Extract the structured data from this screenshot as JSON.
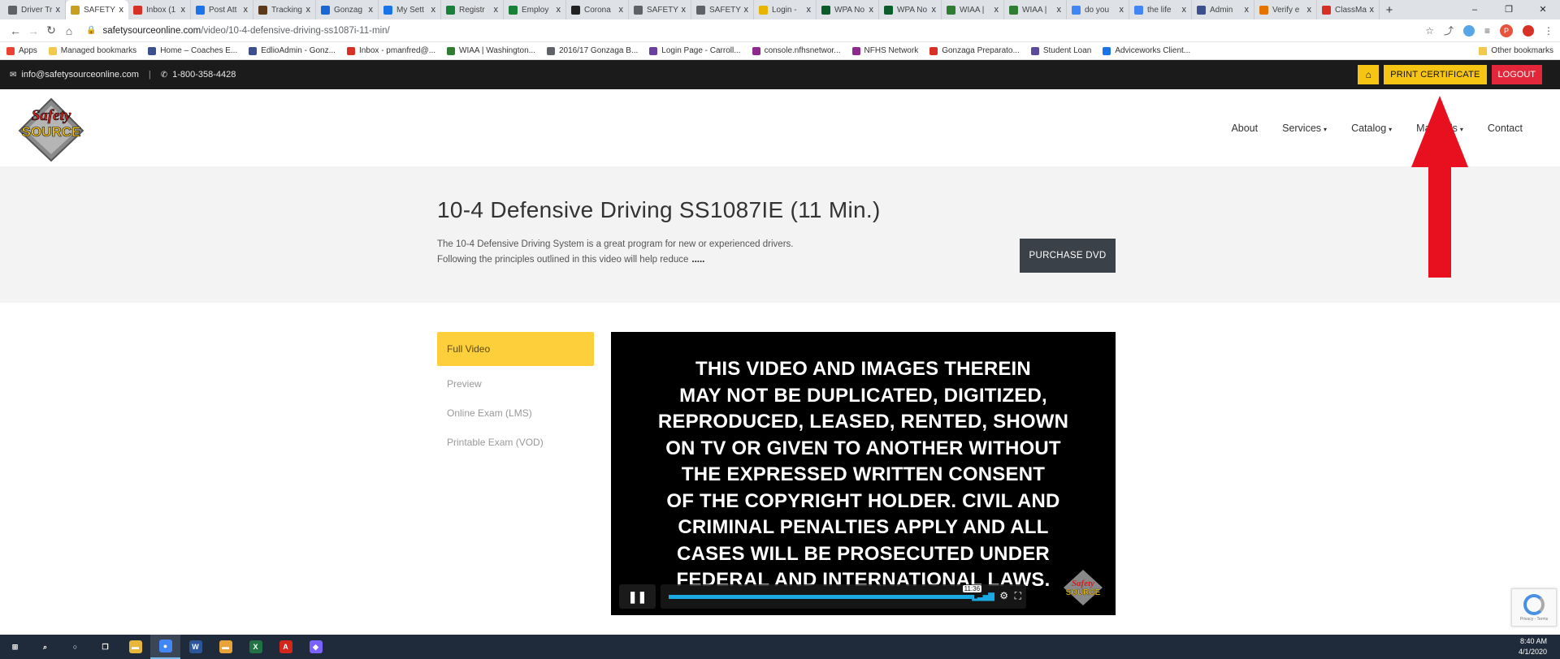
{
  "browser": {
    "tabs": [
      {
        "title": "Driver Tr",
        "color": "#5f6368",
        "active": false
      },
      {
        "title": "SAFETY",
        "color": "#c8a020",
        "active": true
      },
      {
        "title": "Inbox (1",
        "color": "#d93025",
        "active": false
      },
      {
        "title": "Post Att",
        "color": "#1a73e8",
        "active": false
      },
      {
        "title": "Tracking",
        "color": "#5b3a1a",
        "active": false
      },
      {
        "title": "Gonzag",
        "color": "#1967d2",
        "active": false
      },
      {
        "title": "My Sett",
        "color": "#1a73e8",
        "active": false
      },
      {
        "title": "Registr",
        "color": "#188038",
        "active": false
      },
      {
        "title": "Employ",
        "color": "#188038",
        "active": false
      },
      {
        "title": "Corona",
        "color": "#222222",
        "active": false
      },
      {
        "title": "SAFETY",
        "color": "#5f6368",
        "active": false
      },
      {
        "title": "SAFETY",
        "color": "#5f6368",
        "active": false
      },
      {
        "title": "Login -",
        "color": "#e8b400",
        "active": false
      },
      {
        "title": "WPA No",
        "color": "#0b5e2a",
        "active": false
      },
      {
        "title": "WPA No",
        "color": "#0b5e2a",
        "active": false
      },
      {
        "title": "WIAA |",
        "color": "#2e7d32",
        "active": false
      },
      {
        "title": "WIAA |",
        "color": "#2e7d32",
        "active": false
      },
      {
        "title": "do you",
        "color": "#4285f4",
        "active": false
      },
      {
        "title": "the life",
        "color": "#4285f4",
        "active": false
      },
      {
        "title": "Admin",
        "color": "#3c4f8f",
        "active": false
      },
      {
        "title": "Verify e",
        "color": "#e37400",
        "active": false
      },
      {
        "title": "ClassMa",
        "color": "#d93025",
        "active": false
      }
    ],
    "close_glyph": "x",
    "new_tab": "+",
    "window_controls": [
      "–",
      "❐",
      "✕"
    ],
    "url_host": "safetysourceonline.com",
    "url_path": "/video/10-4-defensive-driving-ss1087i-11-min/",
    "profile_initial": "P",
    "bookmarks": [
      {
        "label": "Apps",
        "color": "#ea4335"
      },
      {
        "label": "Managed bookmarks",
        "color": "#f2c94c"
      },
      {
        "label": "Home – Coaches E...",
        "color": "#3c4f8f"
      },
      {
        "label": "EdlioAdmin - Gonz...",
        "color": "#3c4f8f"
      },
      {
        "label": "Inbox - pmanfred@...",
        "color": "#d93025"
      },
      {
        "label": "WIAA | Washington...",
        "color": "#2e7d32"
      },
      {
        "label": "2016/17 Gonzaga B...",
        "color": "#5f6368"
      },
      {
        "label": "Login Page - Carroll...",
        "color": "#6a3fa0"
      },
      {
        "label": "console.nfhsnetwor...",
        "color": "#8e2a8e"
      },
      {
        "label": "NFHS Network",
        "color": "#8e2a8e"
      },
      {
        "label": "Gonzaga Preparato...",
        "color": "#d93025"
      },
      {
        "label": "Student Loan",
        "color": "#5b4a9e"
      },
      {
        "label": "Adviceworks Client...",
        "color": "#1a73e8"
      }
    ],
    "other_bookmarks": "Other bookmarks"
  },
  "site": {
    "email": "info@safetysourceonline.com",
    "separator": "|",
    "phone": "1-800-358-4428",
    "print_certificate": "PRINT CERTIFICATE",
    "logout": "LOGOUT",
    "home_glyph": "⌂",
    "logo_text_top": "Safety",
    "logo_text_bottom": "SOURCE",
    "nav": [
      {
        "label": "About",
        "dropdown": false
      },
      {
        "label": "Services",
        "dropdown": true
      },
      {
        "label": "Catalog",
        "dropdown": true
      },
      {
        "label": "Materials",
        "dropdown": true
      },
      {
        "label": "Contact",
        "dropdown": false
      }
    ],
    "caret": "▾"
  },
  "page": {
    "title": "10-4 Defensive Driving SS1087IE (11 Min.)",
    "desc_line1": "The 10-4 Defensive Driving System is a great program for new or experienced drivers.",
    "desc_line2": "Following the principles outlined in this video will help reduce",
    "desc_more": ".....",
    "purchase": "PURCHASE DVD",
    "sidebar": [
      {
        "label": "Full Video",
        "active": true
      },
      {
        "label": "Preview",
        "active": false
      },
      {
        "label": "Online Exam (LMS)",
        "active": false
      },
      {
        "label": "Printable Exam (VOD)",
        "active": false
      }
    ]
  },
  "video": {
    "lines": [
      "THIS VIDEO AND IMAGES THEREIN",
      "MAY NOT BE DUPLICATED, DIGITIZED,",
      "REPRODUCED, LEASED, RENTED, SHOWN",
      "ON TV OR GIVEN TO ANOTHER WITHOUT",
      "THE EXPRESSED WRITTEN CONSENT",
      "OF THE COPYRIGHT HOLDER. CIVIL AND",
      "CRIMINAL PENALTIES APPLY AND ALL",
      "CASES WILL BE PROSECUTED UNDER",
      "FEDERAL AND INTERNATIONAL LAWS."
    ],
    "time_label": "11:36",
    "progress_fraction": 0.999,
    "pause_glyph": "❚❚",
    "volume_glyph": "▂▃▅▇",
    "settings_glyph": "⚙",
    "fullscreen_glyph": "⛶"
  },
  "recaptcha": {
    "text": "Privacy - Terms"
  },
  "taskbar": {
    "time": "8:40 AM",
    "date": "4/1/2020",
    "apps": [
      {
        "name": "start",
        "glyph": "⊞",
        "color": "transparent"
      },
      {
        "name": "search",
        "glyph": "⌕",
        "color": "transparent"
      },
      {
        "name": "cortana",
        "glyph": "○",
        "color": "transparent"
      },
      {
        "name": "task-view",
        "glyph": "❐",
        "color": "transparent"
      },
      {
        "name": "file-explorer",
        "glyph": "▬",
        "color": "#e8b73a"
      },
      {
        "name": "chrome",
        "glyph": "●",
        "color": "#4285f4"
      },
      {
        "name": "word",
        "glyph": "W",
        "color": "#2b579a"
      },
      {
        "name": "outlook-folder",
        "glyph": "▬",
        "color": "#e8a23a"
      },
      {
        "name": "excel",
        "glyph": "X",
        "color": "#217346"
      },
      {
        "name": "acrobat",
        "glyph": "A",
        "color": "#d4271c"
      },
      {
        "name": "app",
        "glyph": "◆",
        "color": "#7b61ff"
      }
    ]
  }
}
